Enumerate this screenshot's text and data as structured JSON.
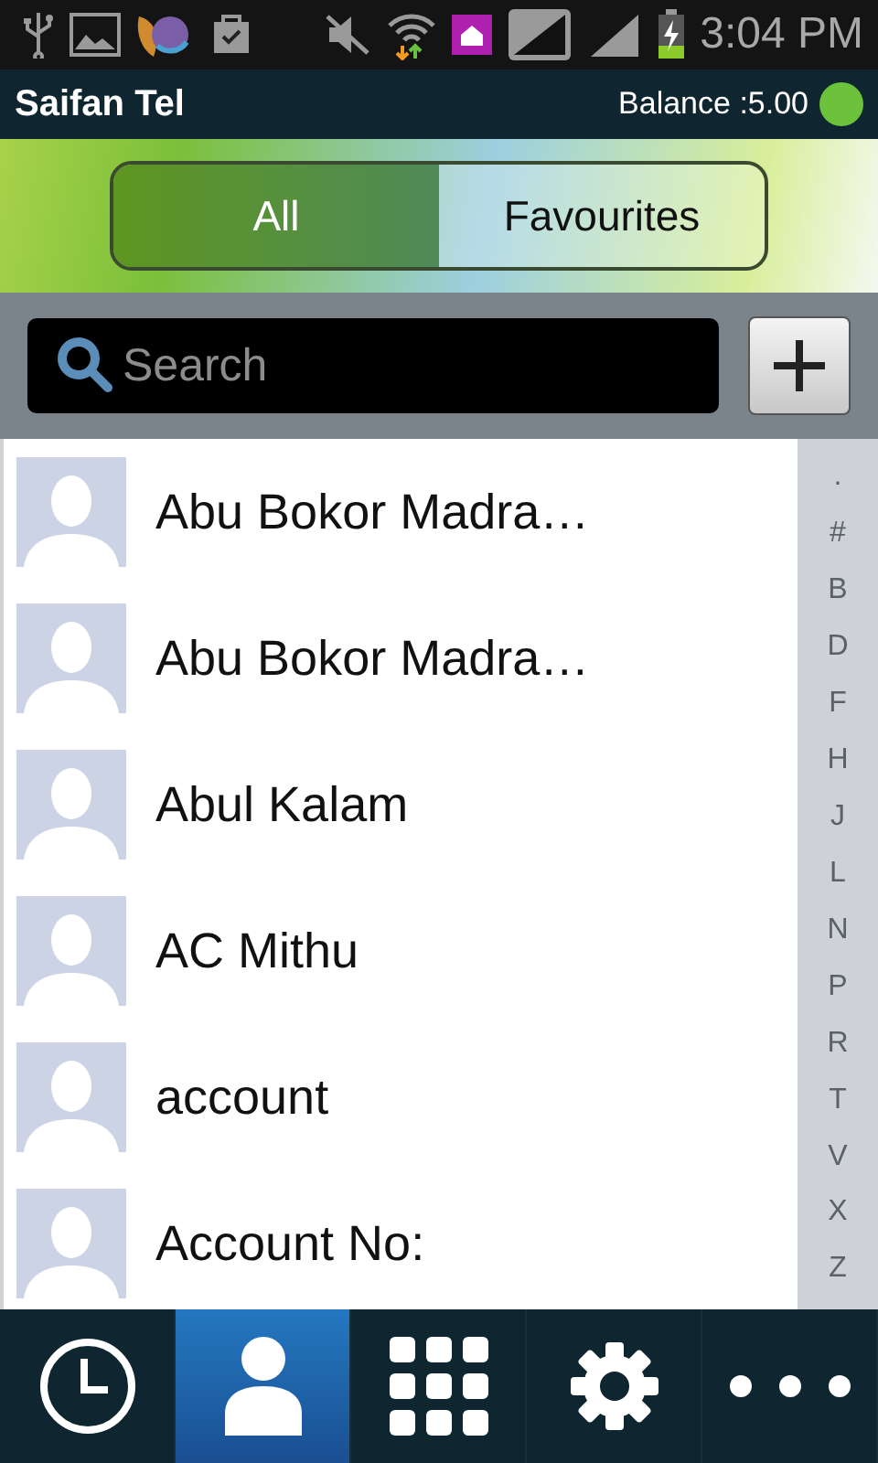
{
  "status_bar": {
    "time": "3:04 PM"
  },
  "app_bar": {
    "title": "Saifan Tel",
    "balance": "Balance :5.00",
    "online": true
  },
  "tabs": [
    {
      "label": "All",
      "selected": true
    },
    {
      "label": "Favourites",
      "selected": false
    }
  ],
  "search": {
    "placeholder": "Search"
  },
  "contacts": [
    {
      "name": "Abu Bokor Madra…"
    },
    {
      "name": "Abu Bokor Madra…"
    },
    {
      "name": "Abul Kalam"
    },
    {
      "name": "AC Mithu"
    },
    {
      "name": "account"
    },
    {
      "name": "Account No:"
    }
  ],
  "index": [
    ".",
    "#",
    "B",
    "D",
    "F",
    "H",
    "J",
    "L",
    "N",
    "P",
    "R",
    "T",
    "V",
    "X",
    "Z"
  ],
  "bottom_nav": [
    {
      "kind": "recent",
      "selected": false
    },
    {
      "kind": "contacts",
      "selected": true
    },
    {
      "kind": "dialpad",
      "selected": false
    },
    {
      "kind": "settings",
      "selected": false
    },
    {
      "kind": "more",
      "selected": false
    }
  ]
}
